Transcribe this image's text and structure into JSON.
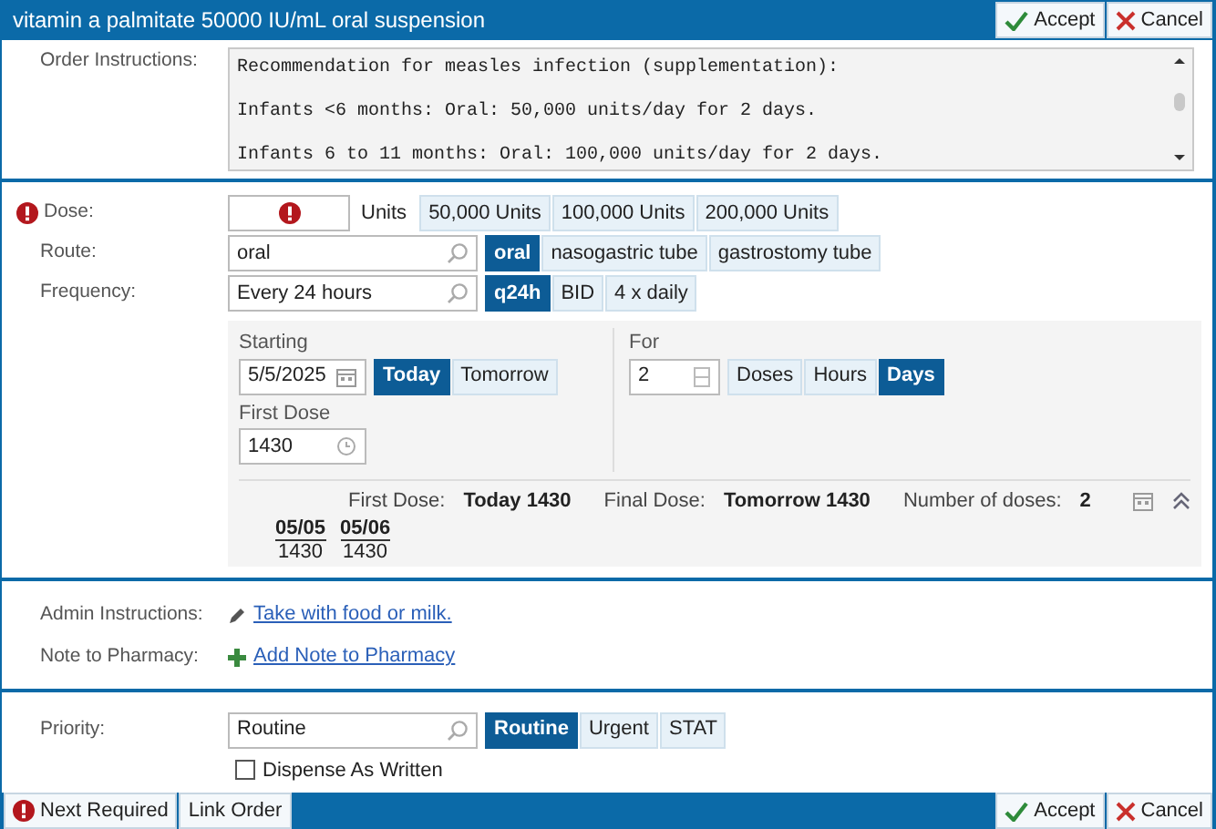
{
  "header": {
    "title": "vitamin a palmitate 50000 IU/mL oral suspension",
    "buttons": [
      {
        "label": "Accept",
        "kind": "accept"
      },
      {
        "label": "Cancel",
        "kind": "cancel"
      }
    ]
  },
  "order_instructions": {
    "label": "Order Instructions:",
    "lines": [
      "Recommendation for measles infection (supplementation):",
      "Infants <6 months: Oral: 50,000 units/day for 2 days.",
      "Infants 6 to 11 months: Oral: 100,000 units/day for 2 days."
    ]
  },
  "dose": {
    "label": "Dose:",
    "required": true,
    "unit": "Units",
    "options": [
      {
        "label": "50,000 Units",
        "selected": false
      },
      {
        "label": "100,000 Units",
        "selected": false
      },
      {
        "label": "200,000 Units",
        "selected": false
      }
    ]
  },
  "route": {
    "label": "Route:",
    "value": "oral",
    "options": [
      {
        "label": "oral",
        "selected": true
      },
      {
        "label": "nasogastric tube",
        "selected": false
      },
      {
        "label": "gastrostomy tube",
        "selected": false
      }
    ]
  },
  "frequency": {
    "label": "Frequency:",
    "value": "Every 24 hours",
    "options": [
      {
        "label": "q24h",
        "selected": true
      },
      {
        "label": "BID",
        "selected": false
      },
      {
        "label": "4 x daily",
        "selected": false
      }
    ]
  },
  "schedule": {
    "starting_label": "Starting",
    "start_date": "5/5/2025",
    "start_options": [
      {
        "label": "Today",
        "selected": true
      },
      {
        "label": "Tomorrow",
        "selected": false
      }
    ],
    "first_dose_label": "First Dose",
    "first_dose": "1430",
    "for_label": "For",
    "for_value": "2",
    "for_options": [
      {
        "label": "Doses",
        "selected": false
      },
      {
        "label": "Hours",
        "selected": false
      },
      {
        "label": "Days",
        "selected": true
      }
    ]
  },
  "summary": {
    "items": [
      {
        "label": "First Dose:",
        "value": "Today 1430"
      },
      {
        "label": "Final Dose:",
        "value": "Tomorrow 1430"
      },
      {
        "label": "Number of doses:",
        "value": "2"
      }
    ],
    "doses": [
      {
        "date": "05/05",
        "time": "1430"
      },
      {
        "date": "05/06",
        "time": "1430"
      }
    ]
  },
  "admin_instructions": {
    "label": "Admin Instructions:",
    "link": "Take with food or milk."
  },
  "note_to_pharmacy": {
    "label": "Note to Pharmacy:",
    "link": "Add Note to Pharmacy"
  },
  "priority": {
    "label": "Priority:",
    "value": "Routine",
    "options": [
      {
        "label": "Routine",
        "selected": true
      },
      {
        "label": "Urgent",
        "selected": false
      },
      {
        "label": "STAT",
        "selected": false
      }
    ]
  },
  "dispense_as_written": {
    "label": "Dispense As Written",
    "checked": false
  },
  "footer": {
    "left_buttons": [
      {
        "label": "Next Required",
        "kind": "next_required"
      },
      {
        "label": "Link Order",
        "kind": "plain"
      }
    ],
    "right_buttons": [
      {
        "label": "Accept",
        "kind": "accept"
      },
      {
        "label": "Cancel",
        "kind": "cancel"
      }
    ]
  }
}
